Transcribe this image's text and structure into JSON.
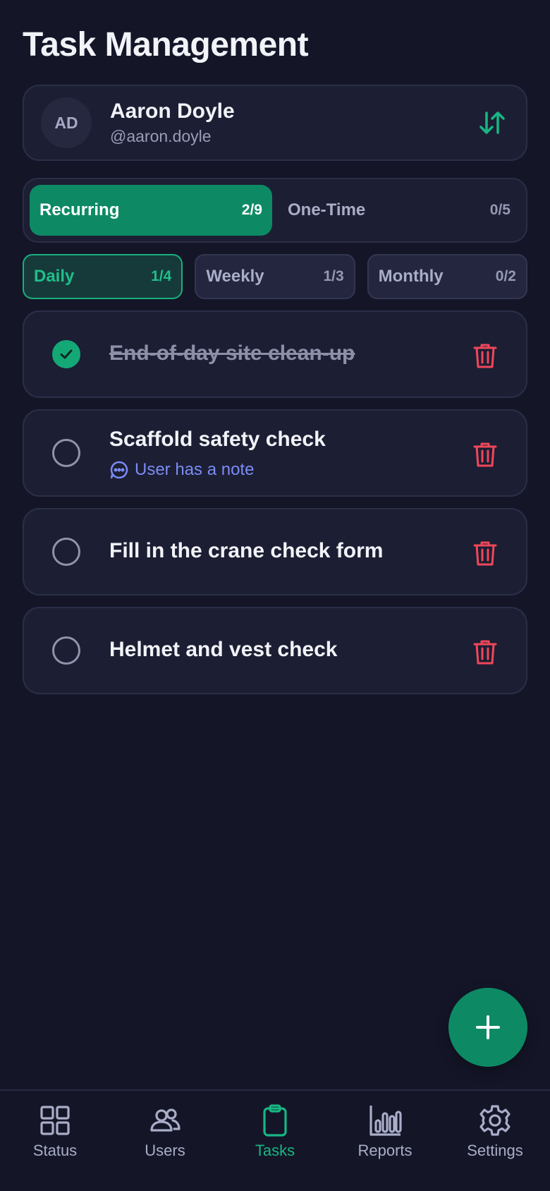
{
  "page": {
    "title": "Task Management"
  },
  "user": {
    "initials": "AD",
    "name": "Aaron Doyle",
    "handle": "@aaron.doyle"
  },
  "task_type_tabs": [
    {
      "label": "Recurring",
      "count": "2/9",
      "active": true
    },
    {
      "label": "One-Time",
      "count": "0/5",
      "active": false
    }
  ],
  "period_tabs": [
    {
      "label": "Daily",
      "count": "1/4",
      "active": true
    },
    {
      "label": "Weekly",
      "count": "1/3",
      "active": false
    },
    {
      "label": "Monthly",
      "count": "0/2",
      "active": false
    }
  ],
  "tasks": [
    {
      "title": "End-of-day site clean-up",
      "done": true
    },
    {
      "title": "Scaffold safety check",
      "done": false,
      "note": "User has a note"
    },
    {
      "title": "Fill in the crane check form",
      "done": false
    },
    {
      "title": "Helmet and vest check",
      "done": false
    }
  ],
  "nav": [
    {
      "label": "Status",
      "icon": "grid-icon"
    },
    {
      "label": "Users",
      "icon": "users-icon"
    },
    {
      "label": "Tasks",
      "icon": "clipboard-icon",
      "active": true
    },
    {
      "label": "Reports",
      "icon": "bar-chart-icon"
    },
    {
      "label": "Settings",
      "icon": "gear-icon"
    }
  ],
  "colors": {
    "background": "#141628",
    "card": "#1c1e33",
    "accent": "#0d8a64",
    "accent_text": "#18b683",
    "danger": "#f0475a",
    "note": "#7b8cf5"
  }
}
